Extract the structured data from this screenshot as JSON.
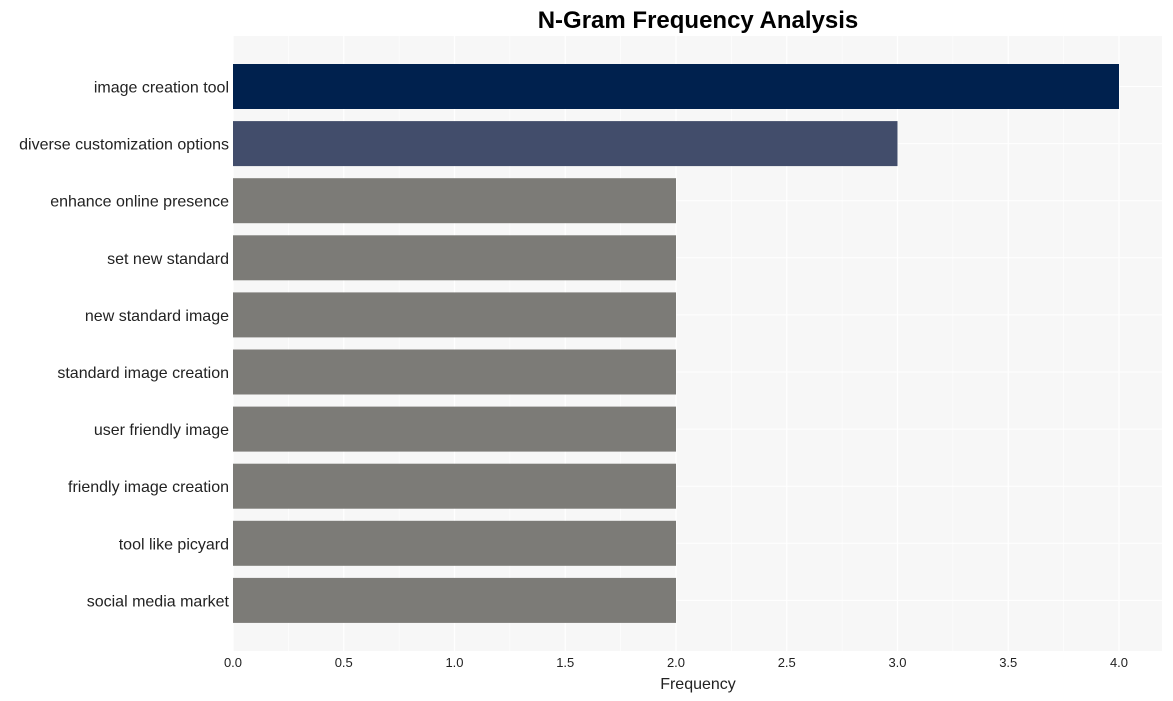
{
  "chart_data": {
    "type": "bar",
    "orientation": "horizontal",
    "title": "N-Gram Frequency Analysis",
    "xlabel": "Frequency",
    "ylabel": "",
    "xlim": [
      0,
      4.2
    ],
    "xticks": [
      0.0,
      0.5,
      1.0,
      1.5,
      2.0,
      2.5,
      3.0,
      3.5,
      4.0
    ],
    "xtick_labels": [
      "0.0",
      "0.5",
      "1.0",
      "1.5",
      "2.0",
      "2.5",
      "3.0",
      "3.5",
      "4.0"
    ],
    "grid": true,
    "categories": [
      "image creation tool",
      "diverse customization options",
      "enhance online presence",
      "set new standard",
      "new standard image",
      "standard image creation",
      "user friendly image",
      "friendly image creation",
      "tool like picyard",
      "social media market"
    ],
    "values": [
      4,
      3,
      2,
      2,
      2,
      2,
      2,
      2,
      2,
      2
    ],
    "colors": [
      "#00214e",
      "#424d6b",
      "#7c7b77",
      "#7c7b77",
      "#7c7b77",
      "#7c7b77",
      "#7c7b77",
      "#7c7b77",
      "#7c7b77",
      "#7c7b77"
    ],
    "background": "#f7f7f7",
    "gridline_color": "#ffffff"
  }
}
